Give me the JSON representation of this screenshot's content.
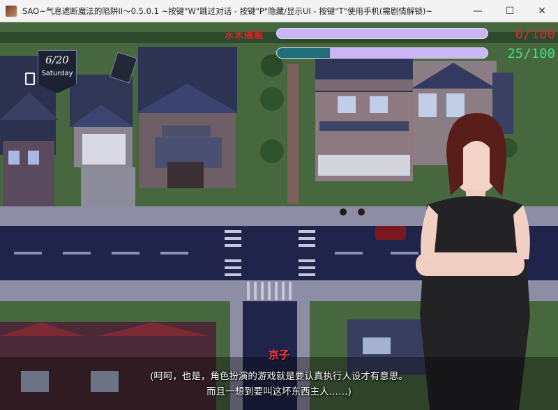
{
  "window": {
    "title": "SAO~气息遮断魔法的陷阱II～0.5.0.1 ~按键\"W\"跳过对话 - 按键\"P\"隐藏/显示UI - 按键\"T\"使用手机(需剧情解锁)~",
    "minimize_glyph": "—",
    "maximize_glyph": "☐",
    "close_glyph": "✕"
  },
  "hud": {
    "date": "6/20",
    "weekday": "Saturday",
    "stat1": {
      "label": "水木催眠",
      "value_text": "0/100",
      "level": 0,
      "color": "#e8232a"
    },
    "stat2": {
      "value_text": "25/100",
      "level": 0.25,
      "color": "#3fe07a"
    }
  },
  "dialog": {
    "speaker": "京子",
    "line1": "(呵呵，也是，角色扮演的游戏就是要认真执行人设才有意思。",
    "line2": "而且一想到要叫这坏东西主人……)"
  }
}
